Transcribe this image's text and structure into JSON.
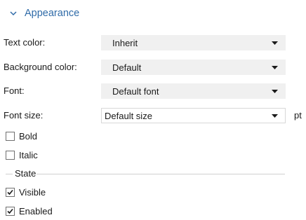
{
  "section": {
    "title": "Appearance",
    "icon": "chevron-down-icon",
    "accent": "#2f6ba8"
  },
  "fields": {
    "text_color": {
      "label": "Text color:",
      "value": "Inherit"
    },
    "background_color": {
      "label": "Background color:",
      "value": "Default"
    },
    "font": {
      "label": "Font:",
      "value": "Default font"
    },
    "font_size": {
      "label": "Font size:",
      "value": "Default size",
      "unit": "pt"
    }
  },
  "checkboxes": {
    "bold": {
      "label": "Bold",
      "checked": false
    },
    "italic": {
      "label": "Italic",
      "checked": false
    }
  },
  "state": {
    "title": "State",
    "visible": {
      "label": "Visible",
      "checked": true
    },
    "enabled": {
      "label": "Enabled",
      "checked": true
    }
  }
}
